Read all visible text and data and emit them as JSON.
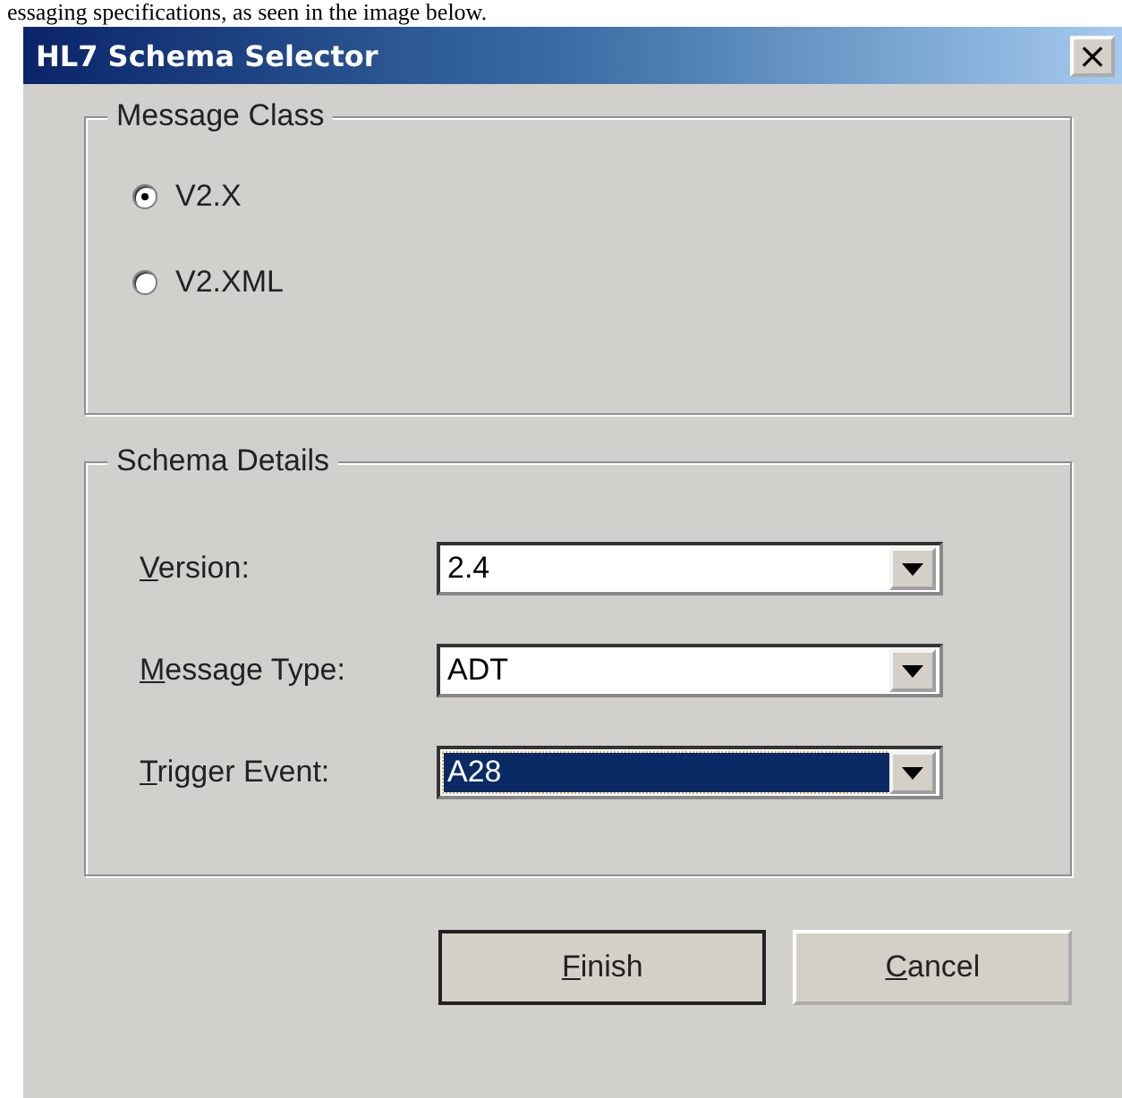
{
  "caption": "essaging specifications, as seen in the image below.",
  "window": {
    "title": "HL7 Schema Selector",
    "close": "×"
  },
  "message_class": {
    "title": "Message Class",
    "options": [
      {
        "label": "V2.X",
        "selected": true
      },
      {
        "label": "V2.XML",
        "selected": false
      }
    ]
  },
  "schema_details": {
    "title": "Schema Details",
    "fields": [
      {
        "key": "V",
        "rest": "ersion:",
        "value": "2.4",
        "focused": false
      },
      {
        "key": "M",
        "rest": "essage Type:",
        "value": "ADT",
        "focused": false
      },
      {
        "key": "T",
        "rest": "rigger Event:",
        "value": "A28",
        "focused": true
      }
    ]
  },
  "buttons": [
    {
      "key": "F",
      "rest": "inish",
      "default": true
    },
    {
      "key": "C",
      "rest": "ancel",
      "default": false
    }
  ]
}
